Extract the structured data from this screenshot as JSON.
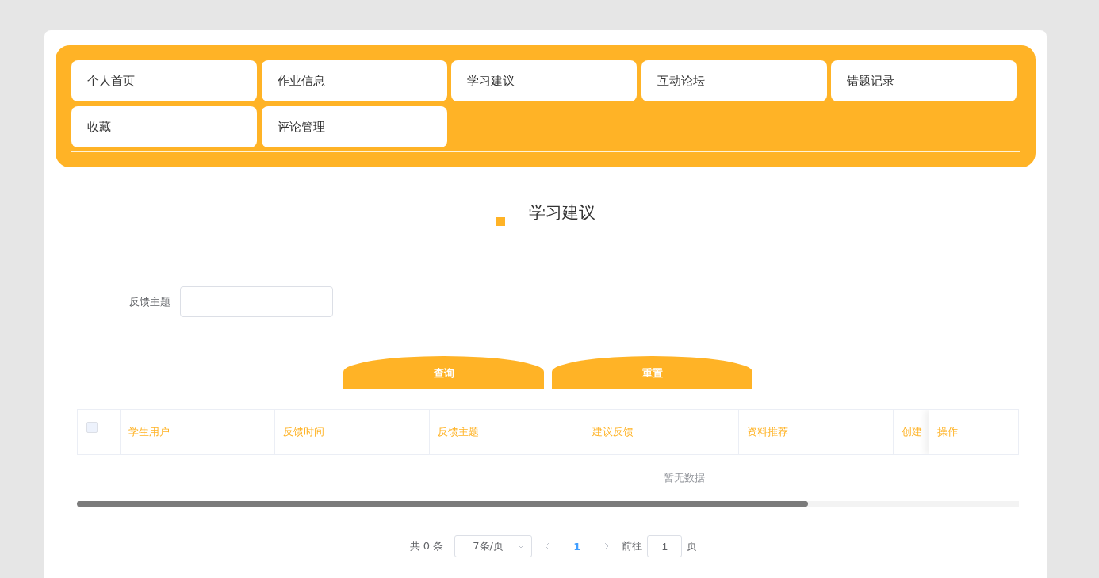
{
  "nav": {
    "items": [
      {
        "label": "个人首页"
      },
      {
        "label": "作业信息"
      },
      {
        "label": "学习建议"
      },
      {
        "label": "互动论坛"
      },
      {
        "label": "错题记录"
      },
      {
        "label": "收藏"
      },
      {
        "label": "评论管理"
      }
    ]
  },
  "page_title": "学习建议",
  "search": {
    "label": "反馈主题"
  },
  "buttons": [
    "查询",
    "重置"
  ],
  "table": {
    "select_all": {
      "checked": false
    },
    "columns": [
      "学生用户",
      "反馈时间",
      "反馈主题",
      "建议反馈",
      "资料推荐",
      "创建"
    ],
    "action_column": "操作",
    "empty_text": "暂无数据"
  },
  "pagination": {
    "total": "共 0 条",
    "page_size": "7条/页",
    "pages": [
      {
        "label": "1",
        "selected": true
      }
    ],
    "goto_label": "前往",
    "goto_value": "1",
    "goto_suffix": "页"
  }
}
